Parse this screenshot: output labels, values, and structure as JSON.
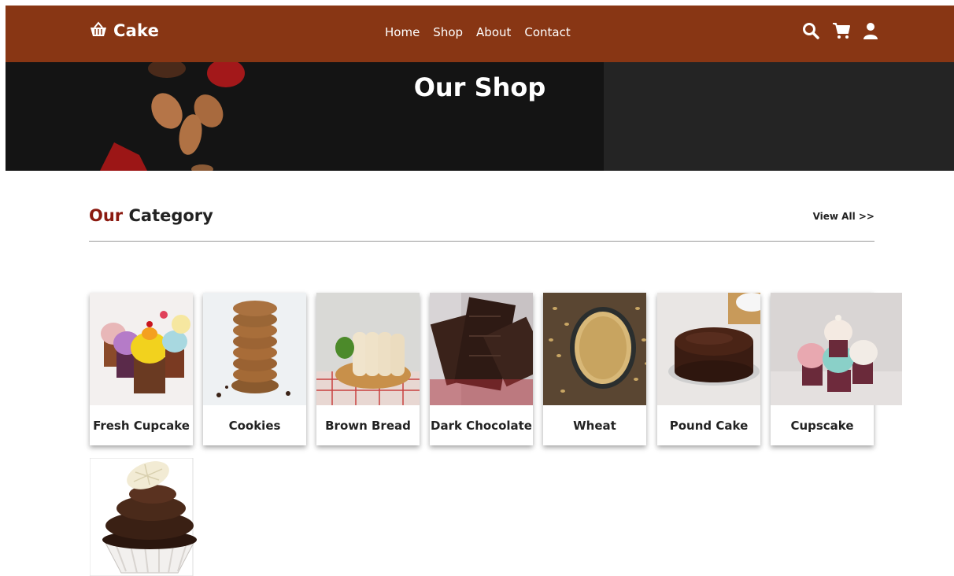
{
  "navbar": {
    "brand": "Cake",
    "links": [
      "Home",
      "Shop",
      "About",
      "Contact"
    ],
    "icons": [
      "search-icon",
      "cart-icon",
      "user-icon"
    ]
  },
  "hero": {
    "title": "Our Shop"
  },
  "category": {
    "title_accent": "Our",
    "title_rest": "Category",
    "view_all": "View All >>",
    "items": [
      {
        "label": "Fresh Cupcake"
      },
      {
        "label": "Cookies"
      },
      {
        "label": "Brown Bread"
      },
      {
        "label": "Dark Chocolate"
      },
      {
        "label": "Wheat"
      },
      {
        "label": "Pound Cake"
      },
      {
        "label": "Cupscake"
      },
      {
        "label": ""
      }
    ]
  },
  "colors": {
    "navbar": "#883614",
    "accent": "#8b1a10",
    "text": "#222222"
  }
}
